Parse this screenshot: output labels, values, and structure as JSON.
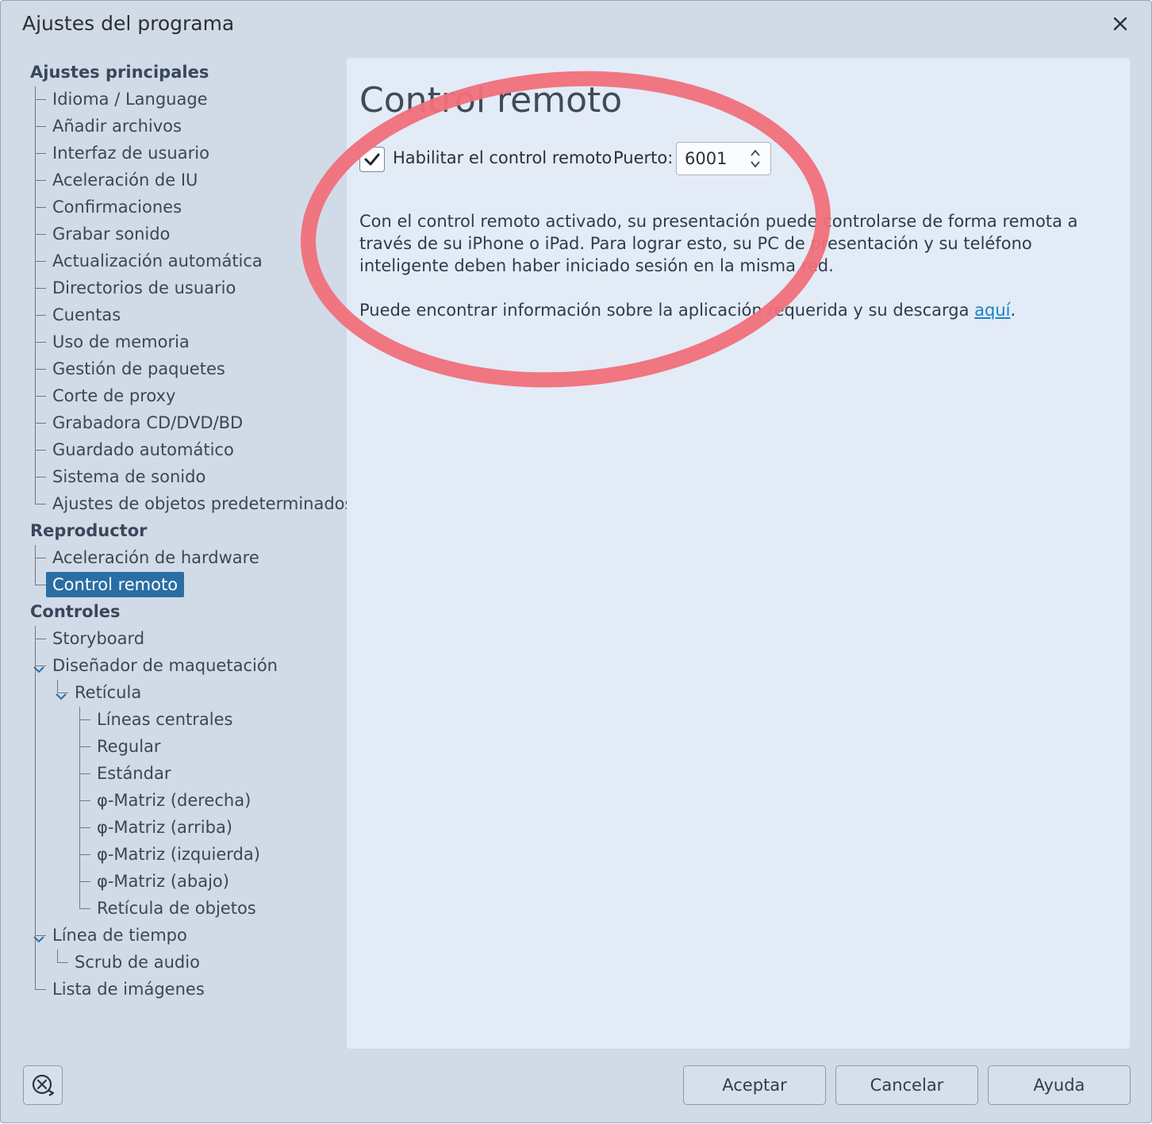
{
  "window": {
    "title": "Ajustes del programa"
  },
  "tree": {
    "groups": [
      {
        "label": "Ajustes principales",
        "items": [
          "Idioma / Language",
          "Añadir archivos",
          "Interfaz de usuario",
          "Aceleración de IU",
          "Confirmaciones",
          "Grabar sonido",
          "Actualización automática",
          "Directorios de usuario",
          "Cuentas",
          "Uso de memoria",
          "Gestión de paquetes",
          "Corte de proxy",
          "Grabadora CD/DVD/BD",
          "Guardado automático",
          "Sistema de sonido",
          "Ajustes de objetos predeterminados"
        ]
      },
      {
        "label": "Reproductor",
        "items": [
          "Aceleración de hardware",
          "Control remoto"
        ]
      },
      {
        "label": "Controles",
        "items": [
          "Storyboard",
          "Diseñador de maquetación",
          "Retícula",
          "Líneas centrales",
          "Regular",
          "Estándar",
          "φ-Matriz (derecha)",
          "φ-Matriz (arriba)",
          "φ-Matriz (izquierda)",
          "φ-Matriz (abajo)",
          "Retícula de objetos",
          "Línea de tiempo",
          "Scrub de audio",
          "Lista de imágenes"
        ]
      }
    ],
    "selected": "Control remoto"
  },
  "panel": {
    "heading": "Control remoto",
    "enable_label": "Habilitar el control remoto",
    "enable_checked": true,
    "port_label": "Puerto:",
    "port_value": "6001",
    "description": "Con el control remoto activado, su presentación puede controlarse de forma remota a través de su iPhone o iPad. Para lograr esto, su PC de presentación y su teléfono inteligente deben haber iniciado sesión en la misma red.",
    "info_prefix": "Puede encontrar información sobre la aplicación requerida y su descarga ",
    "info_link": "aquí",
    "info_suffix": "."
  },
  "footer": {
    "accept": "Aceptar",
    "cancel": "Cancelar",
    "help": "Ayuda"
  },
  "icons": {
    "close": "close-icon",
    "reset": "reset-settings-icon",
    "check": "checkmark-icon"
  },
  "colors": {
    "selection": "#2a6ea4",
    "link": "#1b83c5",
    "annotation": "#f0707a"
  }
}
